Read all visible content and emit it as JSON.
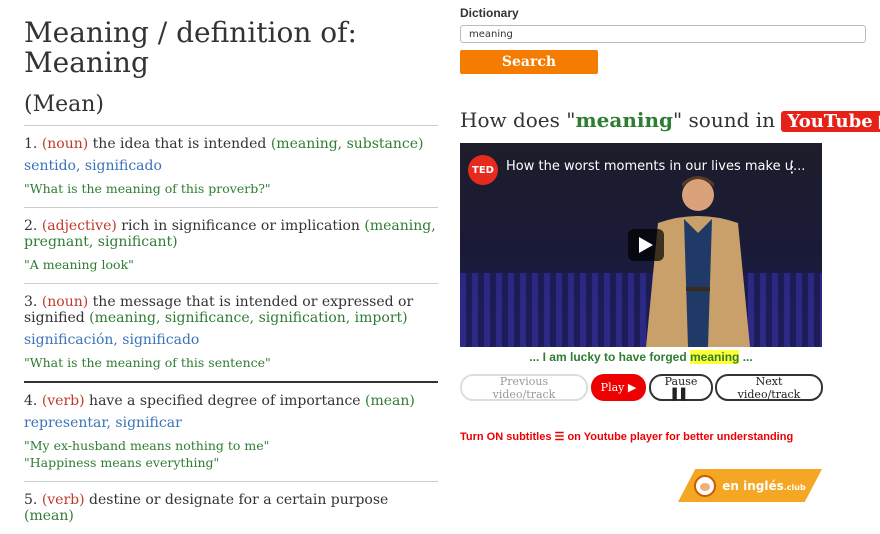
{
  "left": {
    "title_line1": "Meaning / definition of:",
    "title_line2": "Meaning",
    "subtitle": "(Mean)",
    "defs": [
      {
        "num": "1.",
        "pos": "(noun)",
        "gloss": "the idea that is intended",
        "syn": "(meaning, substance)",
        "trans": "sentido, significado",
        "examples": [
          "\"What is the meaning of this proverb?\""
        ]
      },
      {
        "num": "2.",
        "pos": "(adjective)",
        "gloss": "rich in significance or implication",
        "syn": "(meaning, pregnant, significant)",
        "trans": "",
        "examples": [
          "\"A meaning look\""
        ]
      },
      {
        "num": "3.",
        "pos": "(noun)",
        "gloss": "the message that is intended or expressed or signified",
        "syn": "(meaning, significance, signification, import)",
        "trans": "significación, significado",
        "examples": [
          "\"What is the meaning of this sentence\""
        ]
      },
      {
        "num": "4.",
        "pos": "(verb)",
        "gloss": "have a specified degree of importance",
        "syn": "(mean)",
        "trans": "representar, significar",
        "examples": [
          "\"My ex-husband means nothing to me\"",
          "\"Happiness means everything\""
        ]
      },
      {
        "num": "5.",
        "pos": "(verb)",
        "gloss": "destine or designate for a certain purpose",
        "syn": "(mean)",
        "trans": "",
        "examples": []
      }
    ]
  },
  "right": {
    "dict_label": "Dictionary",
    "dict_value": "meaning",
    "search_label": "Search",
    "sound_pre": "How does \"",
    "sound_word": "meaning",
    "sound_mid": "\" sound in ",
    "youtube_label": "YouTube ▶",
    "sound_post": " ?",
    "video_channel": "TED",
    "video_title": "How the worst moments in our lives make u...",
    "video_menu": "⋮",
    "caption_pre": "... I am lucky to have forged ",
    "caption_word": "meaning",
    "caption_post": " ...",
    "prev_label": "Previous video/track",
    "play_label": "Play ▶",
    "pause_label": "Pause ▌▌",
    "next_label": "Next video/track",
    "note": "Turn ON subtitles ☰ on Youtube player for better understanding",
    "brand_main": "en inglés",
    "brand_small": ".club"
  }
}
